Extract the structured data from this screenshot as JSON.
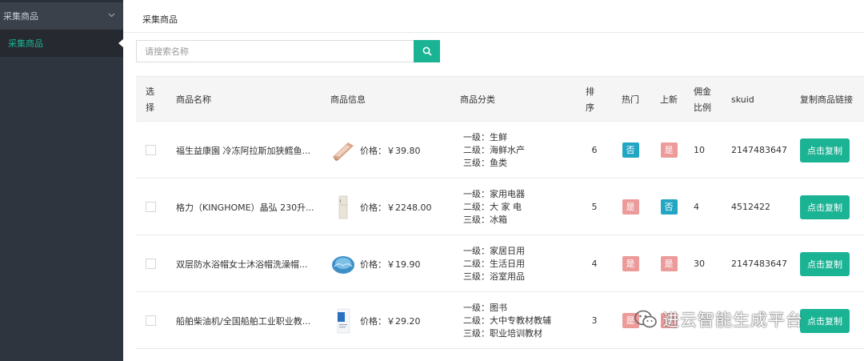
{
  "sidebar": {
    "group_label": "采集商品",
    "active_item": "采集商品"
  },
  "breadcrumb": "采集商品",
  "search": {
    "placeholder": "请搜索名称"
  },
  "table": {
    "headers": {
      "select": "选择",
      "name": "商品名称",
      "info": "商品信息",
      "category": "商品分类",
      "sort": "排序",
      "hot": "热门",
      "new": "上新",
      "ratio": "佣金比例",
      "skuid": "skuid",
      "copy": "复制商品链接"
    },
    "rows": [
      {
        "name": "福生益康園 冷冻阿拉斯加狭鳕鱼...",
        "price": "价格：￥39.80",
        "cat1": "一级：生鲜",
        "cat2": "二级：海鲜水产",
        "cat3": "三级：鱼类",
        "sort": "6",
        "hot": "否",
        "new": "是",
        "ratio": "10",
        "skuid": "2147483647",
        "copy": "点击复制"
      },
      {
        "name": "格力（KINGHOME）晶弘 230升...",
        "price": "价格：￥2248.00",
        "cat1": "一级：家用电器",
        "cat2": "二级：大 家 电",
        "cat3": "三级：冰箱",
        "sort": "5",
        "hot": "是",
        "new": "否",
        "ratio": "4",
        "skuid": "4512422",
        "copy": "点击复制"
      },
      {
        "name": "双层防水浴帽女士沐浴帽洗澡帽...",
        "price": "价格：￥19.90",
        "cat1": "一级：家居日用",
        "cat2": "二级：生活日用",
        "cat3": "三级：浴室用品",
        "sort": "4",
        "hot": "是",
        "new": "是",
        "ratio": "30",
        "skuid": "2147483647",
        "copy": "点击复制"
      },
      {
        "name": "船舶柴油机/全国船舶工业职业教...",
        "price": "价格：￥29.20",
        "cat1": "一级：图书",
        "cat2": "二级：大中专教材教辅",
        "cat3": "三级：职业培训教材",
        "sort": "3",
        "hot": "是",
        "new": "是",
        "ratio": "",
        "skuid": "",
        "copy": "点击复制"
      }
    ]
  },
  "watermark": "进云智能生成平台",
  "colors": {
    "accent": "#1ab394",
    "tag_no": "#23a6c3",
    "tag_yes": "#ec9a9a",
    "sidebar": "#2f353e"
  }
}
